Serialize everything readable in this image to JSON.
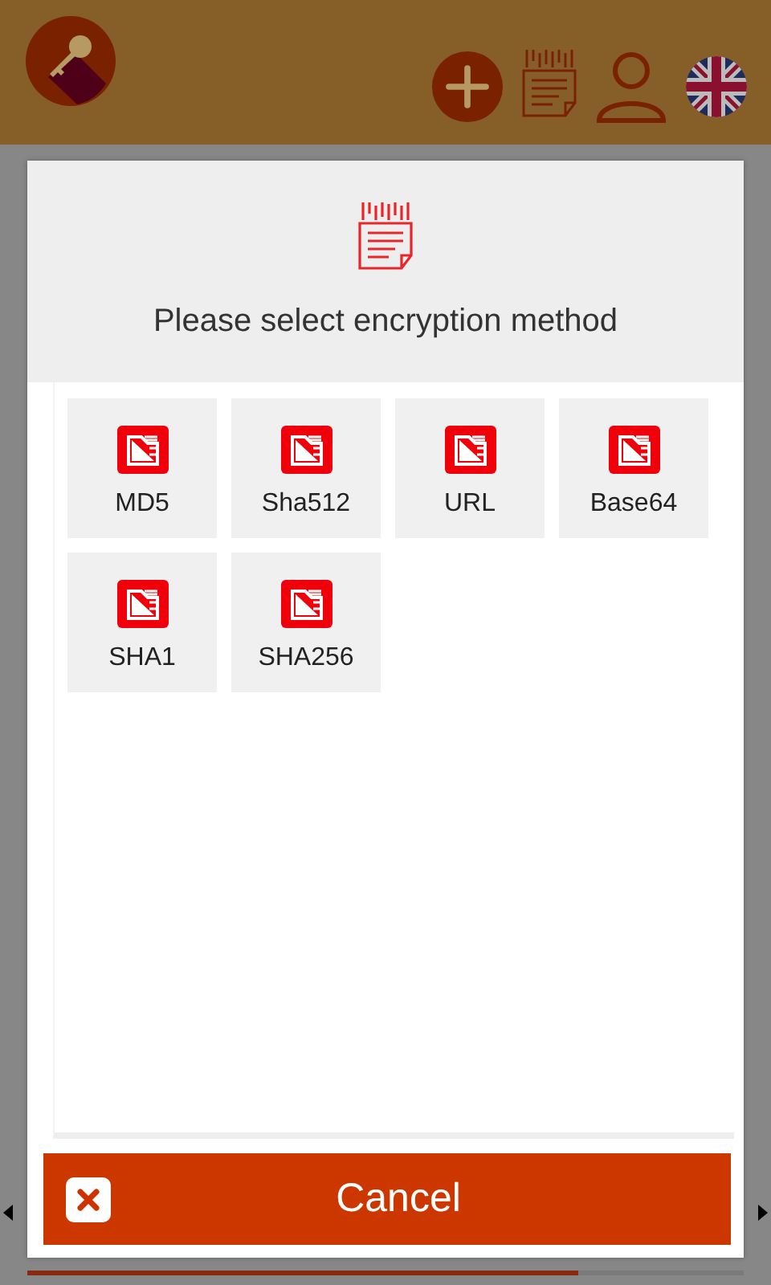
{
  "dialog": {
    "title": "Please select encryption method",
    "methods": [
      {
        "label": "MD5"
      },
      {
        "label": "Sha512"
      },
      {
        "label": "URL"
      },
      {
        "label": "Base64"
      },
      {
        "label": "SHA1"
      },
      {
        "label": "SHA256"
      }
    ],
    "cancel": {
      "label": "Cancel"
    }
  },
  "background_progress": {
    "level": 0.77
  }
}
